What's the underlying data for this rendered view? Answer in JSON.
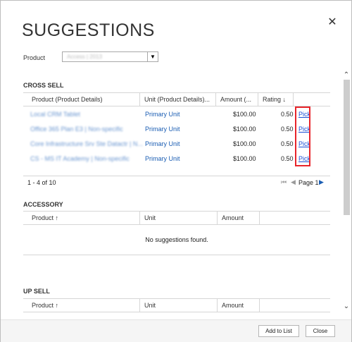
{
  "dialog": {
    "title": "SUGGESTIONS",
    "close_icon": "close-icon"
  },
  "product_filter": {
    "label": "Product",
    "value": "Access | 2013"
  },
  "cross_sell": {
    "title": "CROSS SELL",
    "columns": [
      "Product (Product Details)",
      "Unit (Product Details)...",
      "Amount (...",
      "Rating"
    ],
    "rows": [
      {
        "product": "Local CRM Tablet",
        "unit": "Primary Unit",
        "amount": "$100.00",
        "rating": "0.50",
        "action": "Pick"
      },
      {
        "product": "Office 365 Plan E3 | Non-specific",
        "unit": "Primary Unit",
        "amount": "$100.00",
        "rating": "0.50",
        "action": "Pick"
      },
      {
        "product": "Core Infrastructure Srv Ste Datactr | N...",
        "unit": "Primary Unit",
        "amount": "$100.00",
        "rating": "0.50",
        "action": "Pick"
      },
      {
        "product": "CS - MS IT Academy | Non-specific",
        "unit": "Primary Unit",
        "amount": "$100.00",
        "rating": "0.50",
        "action": "Pick"
      }
    ],
    "record_count": "1 - 4 of 10",
    "page_label": "Page 1"
  },
  "accessory": {
    "title": "ACCESSORY",
    "columns": [
      "Product",
      "Unit",
      "Amount"
    ],
    "empty_text": "No suggestions found."
  },
  "up_sell": {
    "title": "UP SELL",
    "columns": [
      "Product",
      "Unit",
      "Amount"
    ]
  },
  "buttons": {
    "add_to_list": "Add to List",
    "close": "Close"
  }
}
